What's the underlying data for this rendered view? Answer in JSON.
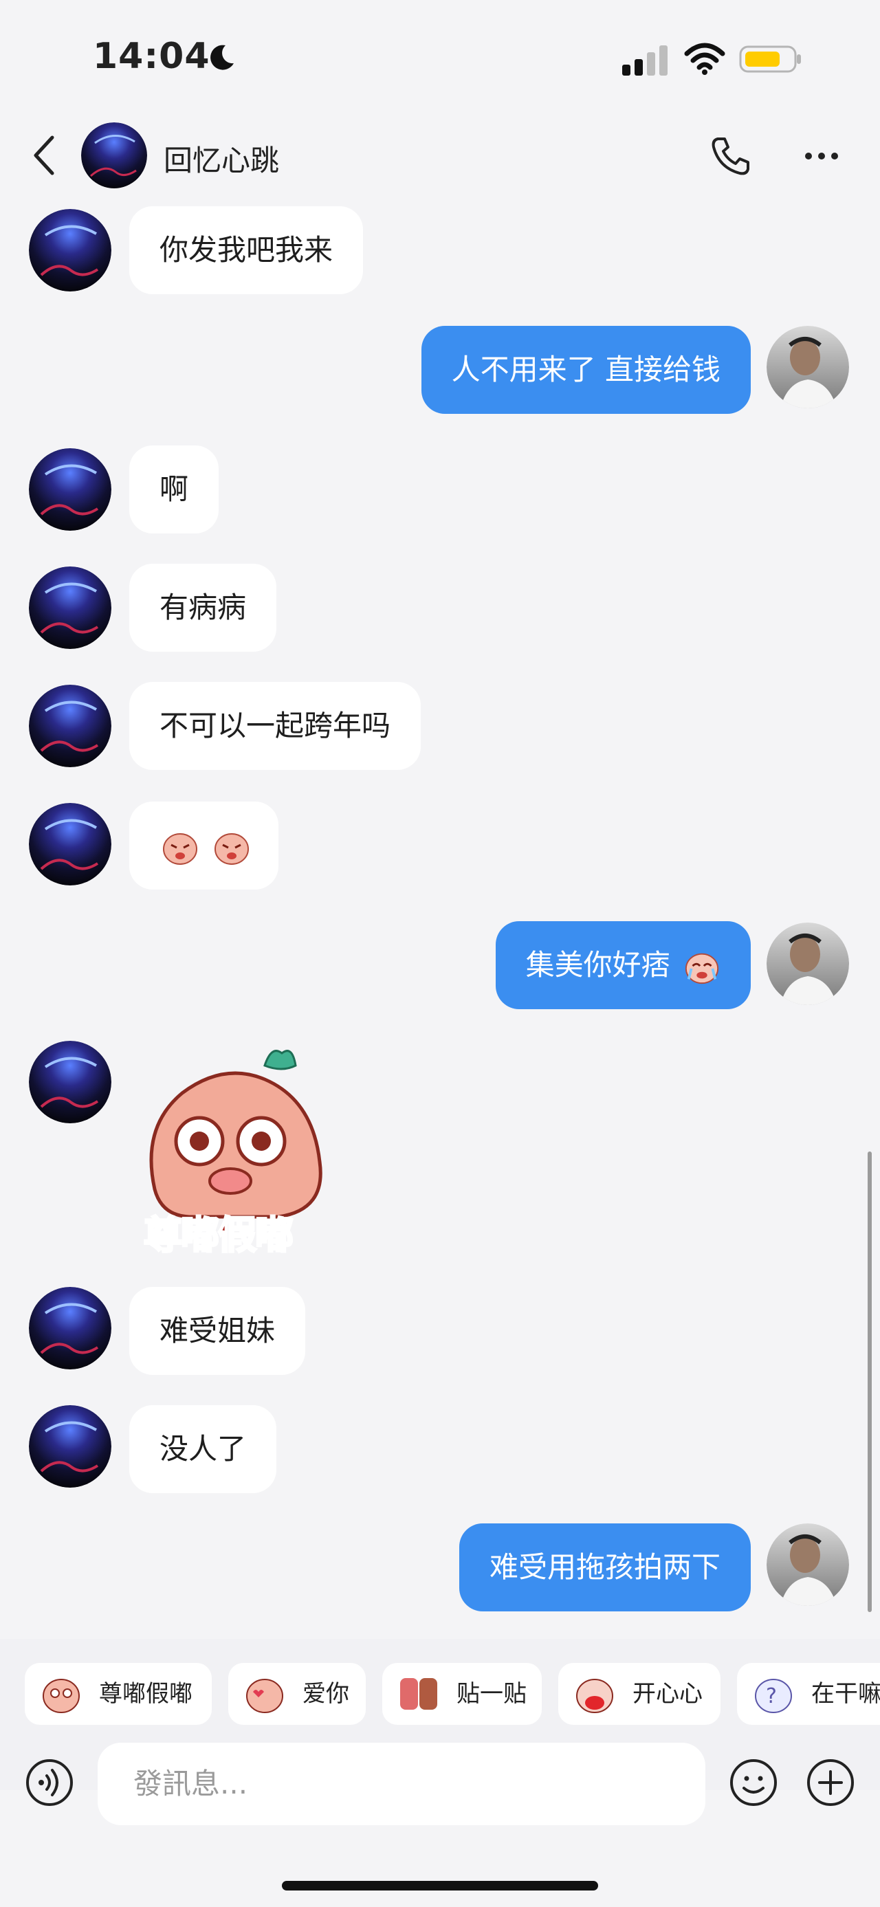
{
  "status": {
    "time": "14:04"
  },
  "header": {
    "title": "回忆心跳"
  },
  "messages": [
    {
      "side": "other",
      "text": "你发我吧我来"
    },
    {
      "side": "self",
      "text": "人不用来了 直接给钱"
    },
    {
      "side": "other",
      "text": "啊"
    },
    {
      "side": "other",
      "text": "有病病"
    },
    {
      "side": "other",
      "text": "不可以一起跨年吗"
    },
    {
      "side": "other",
      "text": "",
      "emoji": "crying-peach-emoji x2"
    },
    {
      "side": "self",
      "text": "集美你好痞"
    },
    {
      "side": "other",
      "sticker_text": "尊嘟假嘟"
    },
    {
      "side": "other",
      "text": "难受姐妹"
    },
    {
      "side": "other",
      "text": "没人了"
    },
    {
      "side": "self",
      "text": "难受用拖孩拍两下"
    }
  ],
  "quick_stickers": [
    {
      "label": "尊嘟假嘟"
    },
    {
      "label": "爱你"
    },
    {
      "label": "贴一贴"
    },
    {
      "label": "开心心"
    },
    {
      "label": "在干嘛"
    }
  ],
  "input": {
    "placeholder": "發訊息..."
  },
  "colors": {
    "self_bubble": "#3b8ef0",
    "other_bubble": "#ffffff",
    "background": "#f4f4f6"
  }
}
